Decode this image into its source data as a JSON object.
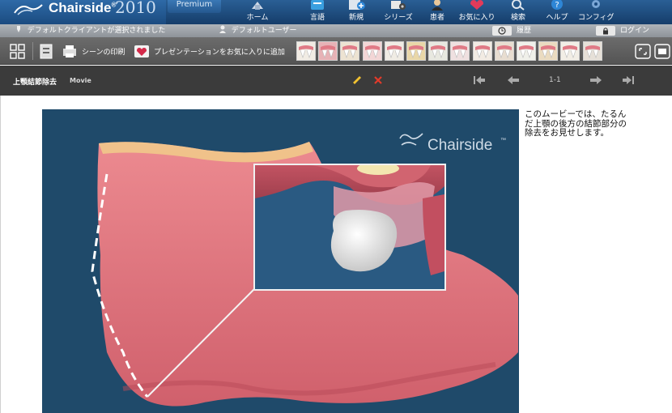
{
  "app": {
    "brand": "Chairside",
    "brand_mark": "®",
    "year": "2010",
    "edition": "Premium"
  },
  "nav": [
    {
      "label": "ホーム",
      "icon": "home-icon"
    },
    {
      "label": "言語",
      "icon": "language-icon"
    },
    {
      "label": "新規",
      "icon": "new-icon"
    },
    {
      "label": "シリーズ",
      "icon": "series-icon"
    },
    {
      "label": "患者",
      "icon": "patient-icon"
    },
    {
      "label": "お気に入り",
      "icon": "favorites-icon"
    },
    {
      "label": "検索",
      "icon": "search-icon"
    },
    {
      "label": "ヘルプ",
      "icon": "help-icon"
    },
    {
      "label": "コンフィグ",
      "icon": "config-icon"
    }
  ],
  "status": {
    "client": "デフォルトクライアントが選択されました",
    "user": "デフォルトユーザー",
    "history": "履歴",
    "login": "ログイン"
  },
  "toolbar": {
    "print_scene": "シーンの印刷",
    "add_favorite": "プレゼンテーションをお気に入りに追加"
  },
  "media": {
    "title": "上顎結節除去",
    "type": "Movie",
    "page": "1-1"
  },
  "video": {
    "watermark": "Chairside",
    "watermark_mark": "™"
  },
  "description": "このムービーでは、たるんだ上顎の後方の結節部分の除去をお見せします。",
  "colors": {
    "nav_blue": "#1b4b80",
    "toolbar_gray": "#5f5f5f",
    "title_dark": "#3b3b3b",
    "video_bg": "#1f4a6a",
    "gum_pink": "#e07880",
    "edit_yellow": "#f2c230",
    "delete_red": "#e23a2a"
  }
}
